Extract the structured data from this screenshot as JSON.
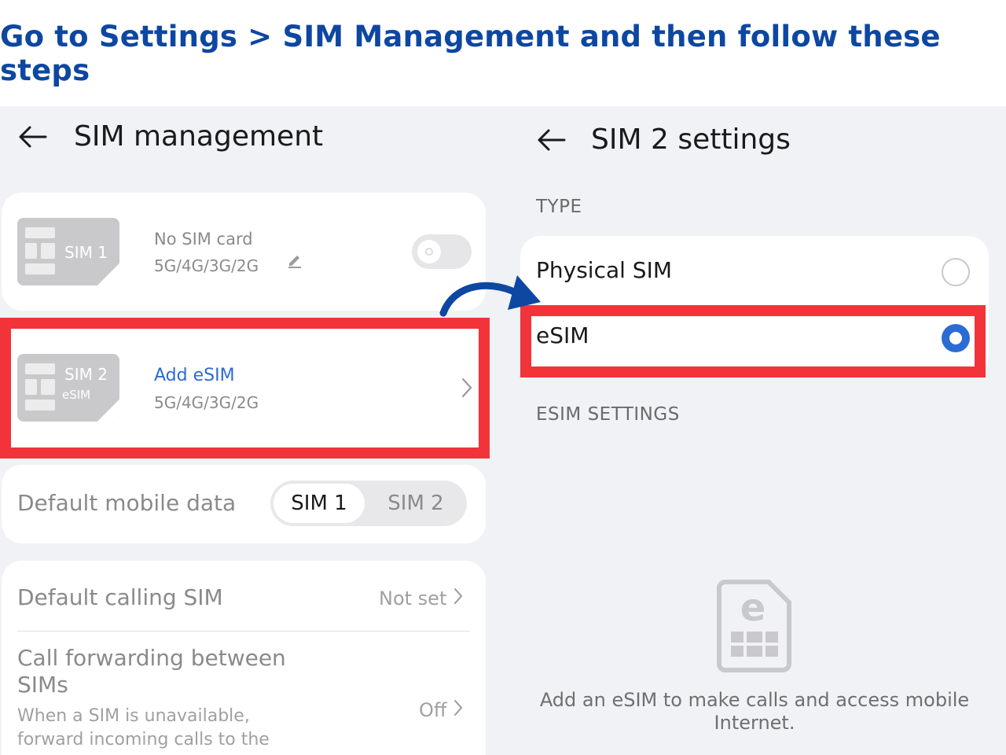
{
  "headline": "Go to Settings > SIM Management and then follow these steps",
  "left": {
    "title": "SIM management",
    "sim1": {
      "chip_label": "SIM 1",
      "status": "No SIM card",
      "network": "5G/4G/3G/2G"
    },
    "sim2": {
      "chip_label": "SIM 2",
      "chip_sub": "eSIM",
      "action": "Add eSIM",
      "network": "5G/4G/3G/2G"
    },
    "default_data": {
      "label": "Default mobile data",
      "options": [
        "SIM 1",
        "SIM 2"
      ],
      "selected": "SIM 1"
    },
    "default_calling": {
      "label": "Default calling SIM",
      "value": "Not set"
    },
    "call_forwarding": {
      "label_line1": "Call forwarding between",
      "label_line2": "SIMs",
      "desc_line1": "When a SIM is unavailable,",
      "desc_line2": "forward incoming calls to the",
      "value": "Off"
    }
  },
  "right": {
    "title": "SIM 2 settings",
    "type_label": "TYPE",
    "options": {
      "physical": "Physical SIM",
      "esim": "eSIM"
    },
    "selected": "eSIM",
    "esim_settings_label": "ESIM SETTINGS",
    "empty_line1": "Add an eSIM to make calls and access mobile",
    "empty_line2": "Internet."
  },
  "colors": {
    "headline": "#0d47a1",
    "highlight": "#f2333a",
    "accent": "#2a6bd6",
    "arrow": "#0d47a1"
  }
}
